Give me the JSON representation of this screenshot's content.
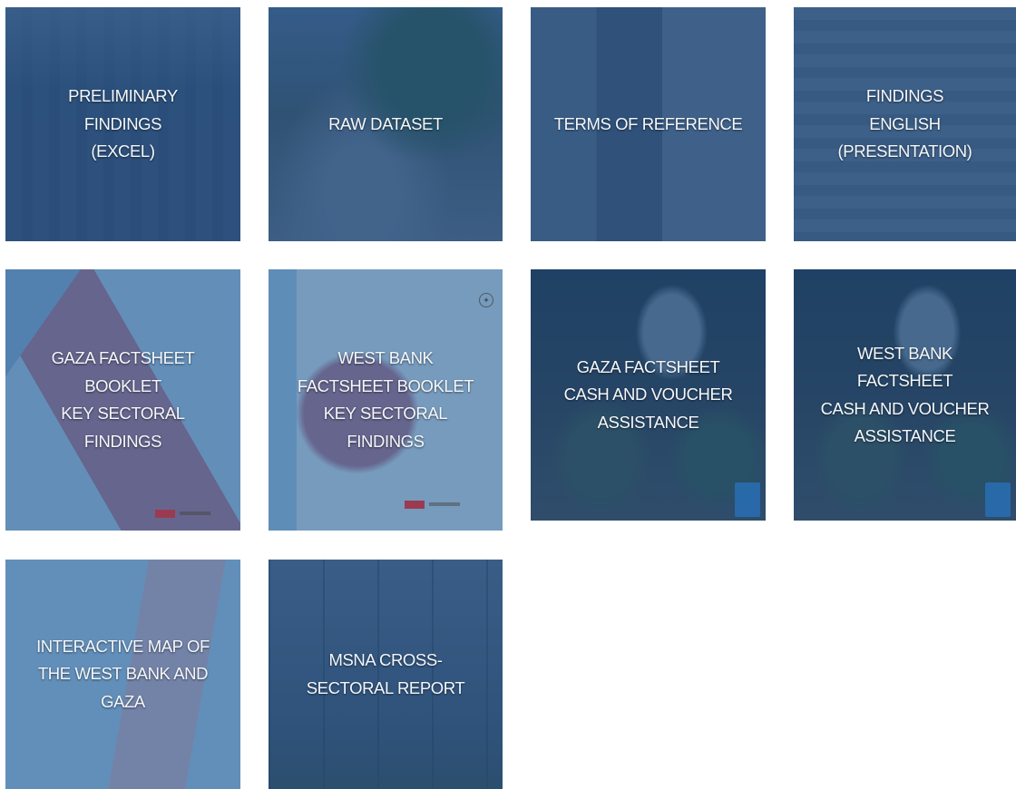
{
  "tiles": [
    {
      "id": "preliminary-findings",
      "lines": [
        "PRELIMINARY",
        "FINDINGS",
        "(EXCEL)"
      ]
    },
    {
      "id": "raw-dataset",
      "lines": [
        "RAW DATASET"
      ]
    },
    {
      "id": "terms-of-reference",
      "lines": [
        "TERMS OF REFERENCE"
      ]
    },
    {
      "id": "findings-english",
      "lines": [
        "FINDINGS",
        "ENGLISH",
        "(PRESENTATION)"
      ]
    },
    {
      "id": "gaza-factsheet-booklet",
      "lines": [
        "GAZA FACTSHEET",
        "BOOKLET",
        "KEY SECTORAL",
        "FINDINGS"
      ]
    },
    {
      "id": "west-bank-factsheet-booklet",
      "lines": [
        "WEST BANK",
        "FACTSHEET BOOKLET",
        "KEY SECTORAL",
        "FINDINGS"
      ]
    },
    {
      "id": "gaza-factsheet-cva",
      "lines": [
        "GAZA FACTSHEET",
        "CASH AND VOUCHER",
        "ASSISTANCE"
      ]
    },
    {
      "id": "west-bank-factsheet-cva",
      "lines": [
        "WEST BANK",
        "FACTSHEET",
        "CASH AND VOUCHER",
        "ASSISTANCE"
      ]
    },
    {
      "id": "interactive-map",
      "lines": [
        "INTERACTIVE MAP OF",
        "THE WEST BANK AND",
        "GAZA"
      ]
    },
    {
      "id": "msna-report",
      "lines": [
        "MSNA CROSS-",
        "SECTORAL REPORT"
      ]
    }
  ]
}
